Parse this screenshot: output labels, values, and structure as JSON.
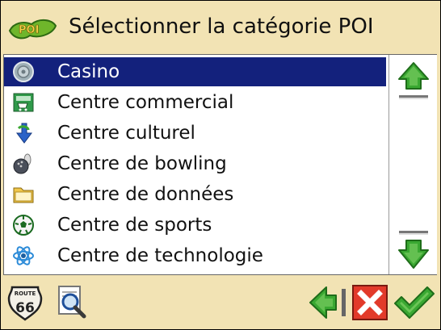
{
  "header": {
    "title": "Sélectionner la catégorie POI"
  },
  "list": {
    "items": [
      {
        "label": "Casino",
        "icon": "casino-icon",
        "selected": true
      },
      {
        "label": "Centre commercial",
        "icon": "shopping-cart-icon",
        "selected": false
      },
      {
        "label": "Centre culturel",
        "icon": "culture-icon",
        "selected": false
      },
      {
        "label": "Centre de bowling",
        "icon": "bowling-icon",
        "selected": false
      },
      {
        "label": "Centre de données",
        "icon": "folder-icon",
        "selected": false
      },
      {
        "label": "Centre de sports",
        "icon": "soccer-ball-icon",
        "selected": false
      },
      {
        "label": "Centre de technologie",
        "icon": "atom-icon",
        "selected": false
      }
    ]
  },
  "footer": {
    "route_badge_top": "ROUTE",
    "route_badge_number": "66"
  },
  "colors": {
    "background": "#f2e3b4",
    "selection": "#13217c",
    "arrow_green": "#3aa832",
    "cancel_red": "#e23a2a"
  }
}
